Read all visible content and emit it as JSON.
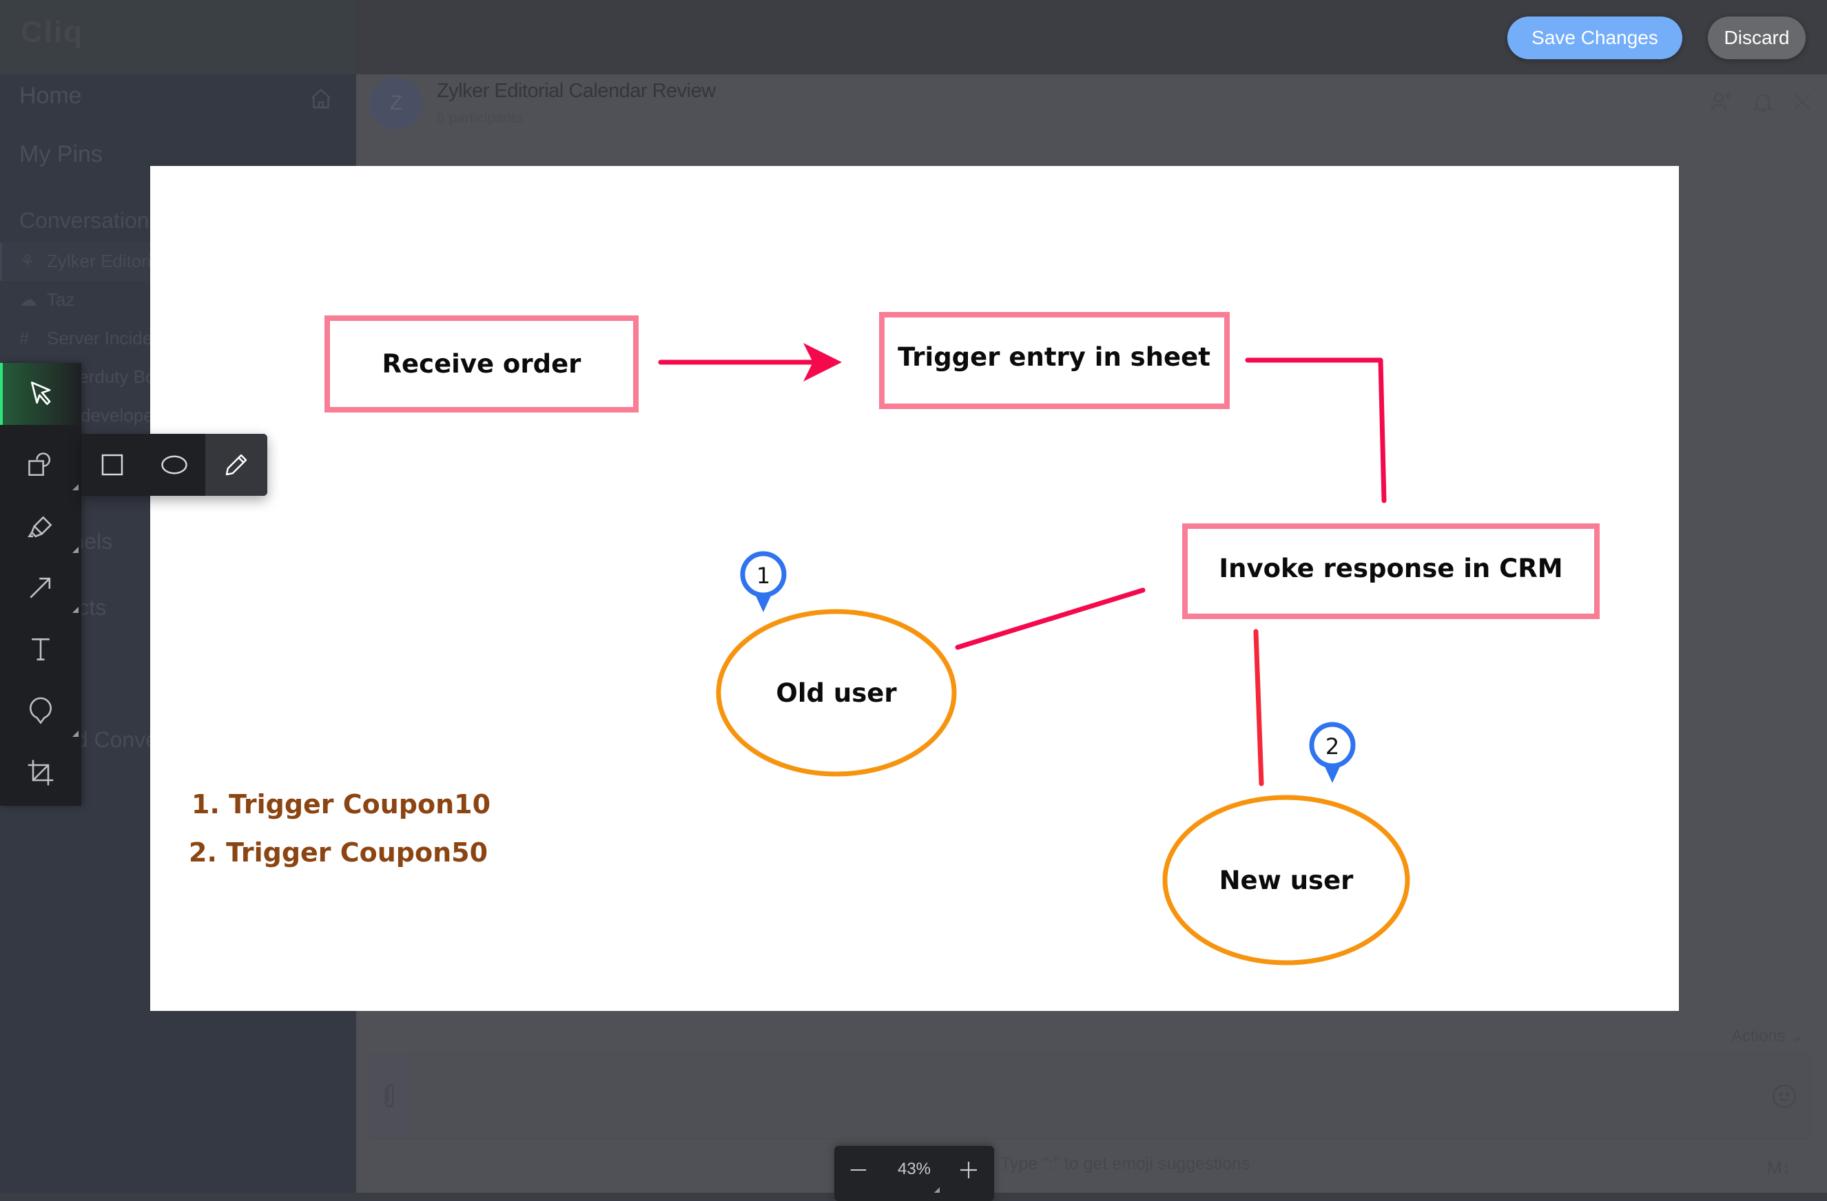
{
  "app": {
    "logo_text": "Cliq"
  },
  "sidebar": {
    "home_label": "Home",
    "pins_label": "My Pins",
    "conversations_title": "Conversations",
    "conversations": [
      {
        "icon": "group-icon",
        "label": "Zylker Editorial Calendar Review"
      },
      {
        "icon": "bot-icon",
        "label": "Taz"
      },
      {
        "icon": "hash-icon",
        "label": "Server Incidents"
      },
      {
        "icon": "more-icon",
        "label": "Pagerduty Bot"
      },
      {
        "icon": "hash-icon",
        "label": "site-developers"
      }
    ],
    "channels_title": "Channels",
    "contacts_title": "Contacts",
    "closed_title": "Closed Conversations"
  },
  "chat": {
    "avatar_letter": "Z",
    "title": "Zylker Editorial Calendar Review",
    "subtitle": "6 participants",
    "actions_label": "Actions",
    "composer_hint": "Type \":\" to get emoji suggestions",
    "markdown_label": "M↓"
  },
  "editor": {
    "save_label": "Save Changes",
    "discard_label": "Discard",
    "zoom_value": "43%",
    "zoom_out_label": "—",
    "zoom_in_label": "+",
    "tools": [
      "select",
      "shapes",
      "highlighter",
      "arrow",
      "text",
      "callout",
      "crop"
    ],
    "active_tool": "select",
    "shape_flyout": [
      "rectangle",
      "ellipse",
      "pencil"
    ],
    "active_shape": "pencil",
    "colors": {
      "box_border": "#F87D95",
      "connector": "#F5094D",
      "ellipse": "#F7940F",
      "marker": "#2F73EE",
      "legend_text": "#8B4513",
      "save_button": "#74AEF9",
      "active_tool_accent": "#2FE27E"
    }
  },
  "diagram": {
    "boxes": [
      {
        "id": "receive",
        "label": "Receive order"
      },
      {
        "id": "trigger",
        "label": "Trigger entry in sheet"
      },
      {
        "id": "crm",
        "label": "Invoke response in CRM"
      }
    ],
    "ellipses": [
      {
        "id": "old",
        "label": "Old user"
      },
      {
        "id": "new",
        "label": "New user"
      }
    ],
    "markers": [
      {
        "id": "m1",
        "label": "1"
      },
      {
        "id": "m2",
        "label": "2"
      }
    ],
    "legend": [
      "1. Trigger Coupon10",
      "2. Trigger Coupon50"
    ]
  }
}
